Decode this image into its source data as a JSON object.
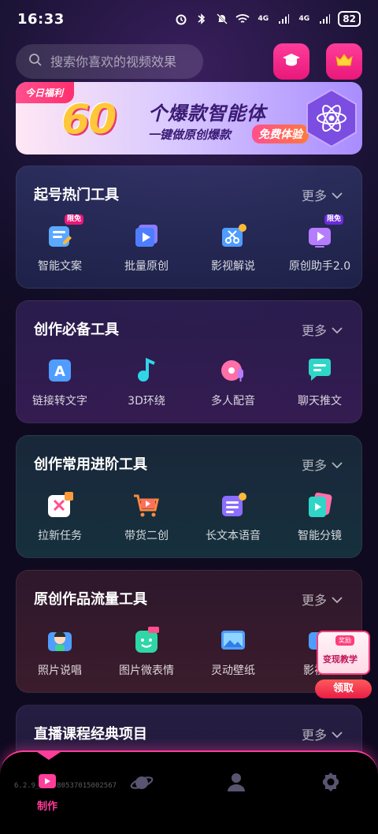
{
  "status_bar": {
    "time": "16:33",
    "network_1": "4G",
    "network_2": "4G",
    "battery": "82"
  },
  "search": {
    "placeholder": "搜索你喜欢的视频效果"
  },
  "header_buttons": {
    "course_icon": "graduation-cap-icon",
    "vip_icon": "crown-icon"
  },
  "banner": {
    "tag": "今日福利",
    "number": "60",
    "title": "个爆款智能体",
    "subtitle": "一键做原创爆款",
    "cta": "免费体验"
  },
  "sections": [
    {
      "title": "起号热门工具",
      "more": "更多",
      "tools": [
        {
          "label": "智能文案",
          "badge": "限免"
        },
        {
          "label": "批量原创",
          "badge": ""
        },
        {
          "label": "影视解说",
          "badge": ""
        },
        {
          "label": "原创助手2.0",
          "badge": "限免"
        }
      ]
    },
    {
      "title": "创作必备工具",
      "more": "更多",
      "tools": [
        {
          "label": "链接转文字",
          "badge": ""
        },
        {
          "label": "3D环绕",
          "badge": ""
        },
        {
          "label": "多人配音",
          "badge": ""
        },
        {
          "label": "聊天推文",
          "badge": ""
        }
      ]
    },
    {
      "title": "创作常用进阶工具",
      "more": "更多",
      "tools": [
        {
          "label": "拉新任务",
          "badge": ""
        },
        {
          "label": "带货二创",
          "badge": ""
        },
        {
          "label": "长文本语音",
          "badge": ""
        },
        {
          "label": "智能分镜",
          "badge": ""
        }
      ]
    },
    {
      "title": "原创作品流量工具",
      "more": "更多",
      "tools": [
        {
          "label": "照片说唱",
          "badge": ""
        },
        {
          "label": "图片微表情",
          "badge": ""
        },
        {
          "label": "灵动壁纸",
          "badge": ""
        },
        {
          "label": "影视解",
          "badge": ""
        }
      ]
    },
    {
      "title": "直播课程经典项目",
      "more": "更多",
      "tools": []
    }
  ],
  "float_promo": {
    "small": "奖励",
    "title": "变现教学",
    "button": "领取"
  },
  "tabbar": {
    "version": "6.2.9_1...80537015002567",
    "make_label": "制作"
  },
  "colors": {
    "accent": "#ff3d9a",
    "background": "#120d26"
  }
}
